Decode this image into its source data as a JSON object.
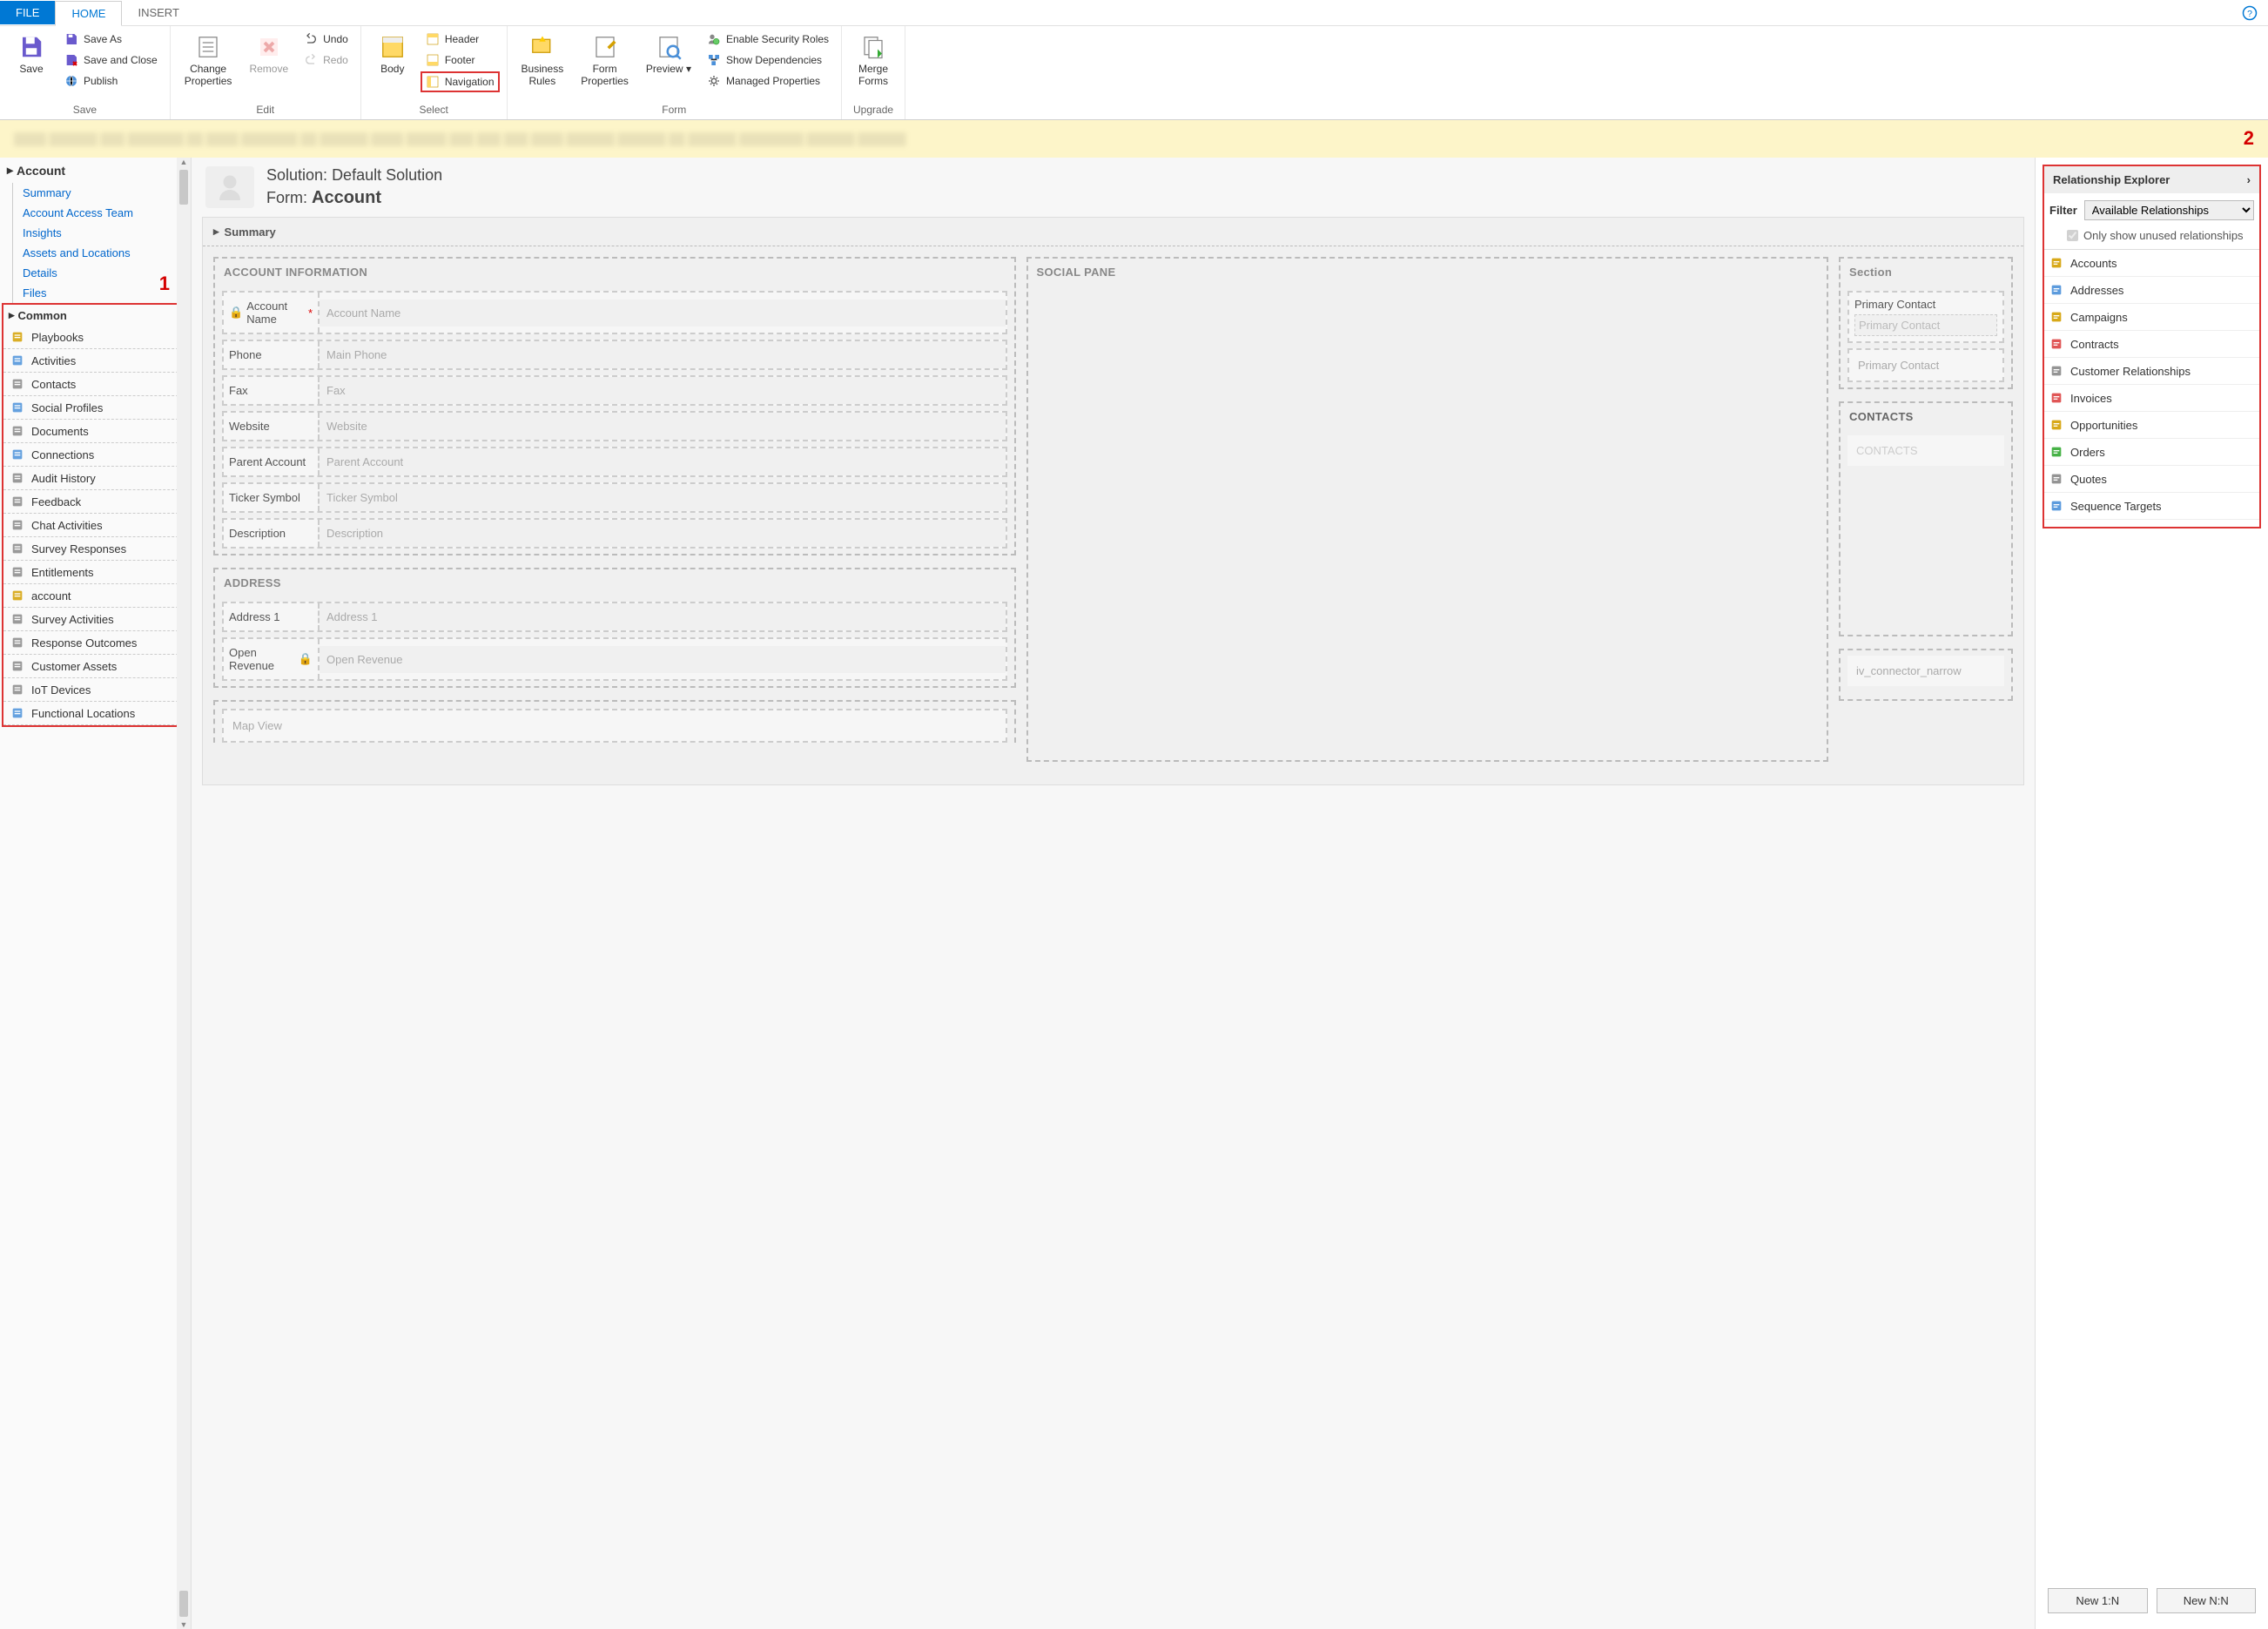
{
  "tabs": {
    "file": "FILE",
    "home": "HOME",
    "insert": "INSERT"
  },
  "ribbon": {
    "save_group": "Save",
    "save": "Save",
    "save_as": "Save As",
    "save_close": "Save and Close",
    "publish": "Publish",
    "edit_group": "Edit",
    "change_props": "Change\nProperties",
    "remove": "Remove",
    "undo": "Undo",
    "redo": "Redo",
    "select_group": "Select",
    "body": "Body",
    "header": "Header",
    "footer": "Footer",
    "navigation": "Navigation",
    "form_group": "Form",
    "biz_rules": "Business\nRules",
    "form_props": "Form\nProperties",
    "preview": "Preview",
    "enable_sec": "Enable Security Roles",
    "show_deps": "Show Dependencies",
    "managed_props": "Managed Properties",
    "upgrade_group": "Upgrade",
    "merge_forms": "Merge\nForms"
  },
  "left": {
    "account": "Account",
    "items": [
      "Summary",
      "Account Access Team",
      "Insights",
      "Assets and Locations",
      "Details",
      "Files"
    ],
    "common": "Common",
    "common_items": [
      "Playbooks",
      "Activities",
      "Contacts",
      "Social Profiles",
      "Documents",
      "Connections",
      "Audit History",
      "Feedback",
      "Chat Activities",
      "Survey Responses",
      "Entitlements",
      "account",
      "Survey Activities",
      "Response Outcomes",
      "Customer Assets",
      "IoT Devices",
      "Functional Locations"
    ]
  },
  "canvas": {
    "solution_prefix": "Solution: ",
    "solution": "Default Solution",
    "form_prefix": "Form: ",
    "form_name": "Account",
    "summary": "Summary",
    "acct_info": "ACCOUNT INFORMATION",
    "fields": [
      {
        "label": "Account Name",
        "ph": "Account Name",
        "req": true,
        "lock": true
      },
      {
        "label": "Phone",
        "ph": "Main Phone"
      },
      {
        "label": "Fax",
        "ph": "Fax"
      },
      {
        "label": "Website",
        "ph": "Website"
      },
      {
        "label": "Parent Account",
        "ph": "Parent Account"
      },
      {
        "label": "Ticker Symbol",
        "ph": "Ticker Symbol"
      },
      {
        "label": "Description",
        "ph": "Description"
      }
    ],
    "address": "ADDRESS",
    "addr_fields": [
      {
        "label": "Address 1",
        "ph": "Address 1"
      },
      {
        "label": "Open Revenue",
        "ph": "Open Revenue",
        "lock": true
      }
    ],
    "map_view": "Map View",
    "social": "SOCIAL PANE",
    "section": "Section",
    "primary_contact": "Primary Contact",
    "primary_contact_ph": "Primary Contact",
    "contacts": "CONTACTS",
    "contacts_ph": "CONTACTS",
    "iv_conn": "iv_connector_narrow"
  },
  "right": {
    "title": "Relationship Explorer",
    "filter_label": "Filter",
    "filter_value": "Available Relationships",
    "only_unused": "Only show unused relationships",
    "items": [
      "Accounts",
      "Addresses",
      "Campaigns",
      "Contracts",
      "Customer Relationships",
      "Invoices",
      "Opportunities",
      "Orders",
      "Quotes",
      "Sequence Targets"
    ],
    "new_1n": "New 1:N",
    "new_nn": "New N:N"
  },
  "callouts": {
    "one": "1",
    "two": "2"
  }
}
